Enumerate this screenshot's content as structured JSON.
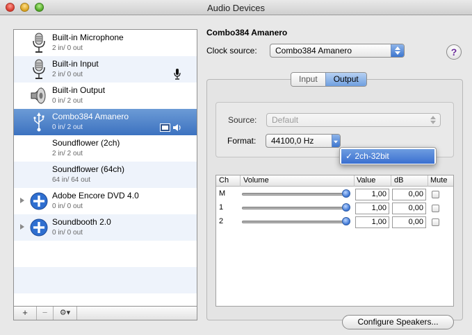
{
  "window": {
    "title": "Audio Devices"
  },
  "devices": [
    {
      "name": "Built-in Microphone",
      "io": "2 in/ 0 out",
      "icon": "microphone-icon"
    },
    {
      "name": "Built-in Input",
      "io": "2 in/ 0 out",
      "icon": "microphone-icon"
    },
    {
      "name": "Built-in Output",
      "io": "0 in/ 2 out",
      "icon": "speaker-icon"
    },
    {
      "name": "Combo384 Amanero",
      "io": "0 in/ 2 out",
      "icon": "usb-icon"
    },
    {
      "name": "Soundflower (2ch)",
      "io": "2 in/ 2 out",
      "icon": ""
    },
    {
      "name": "Soundflower (64ch)",
      "io": "64 in/ 64 out",
      "icon": ""
    },
    {
      "name": "Adobe Encore DVD 4.0",
      "io": "0 in/ 0 out",
      "icon": "aggregate-plus-icon"
    },
    {
      "name": "Soundbooth 2.0",
      "io": "0 in/ 0 out",
      "icon": "aggregate-plus-icon"
    }
  ],
  "toolbar": {
    "add_label": "+",
    "remove_label": "−",
    "gear_label": "⚙▾"
  },
  "detail": {
    "device_name": "Combo384 Amanero",
    "clock_source_label": "Clock source:",
    "clock_source_value": "Combo384 Amanero",
    "help_label": "?",
    "tabs": [
      "Input",
      "Output"
    ],
    "active_tab": "Output",
    "source_label": "Source:",
    "source_value": "Default",
    "format_label": "Format:",
    "format_rate": "44100,0 Hz",
    "format_menu_item": "✓ 2ch-32bit"
  },
  "channel_table": {
    "headers": {
      "ch": "Ch",
      "volume": "Volume",
      "value": "Value",
      "db": "dB",
      "mute": "Mute"
    },
    "rows": [
      {
        "ch": "M",
        "volume_fraction": 1.0,
        "value": "1,00",
        "db": "0,00",
        "mute": false
      },
      {
        "ch": "1",
        "volume_fraction": 1.0,
        "value": "1,00",
        "db": "0,00",
        "mute": false
      },
      {
        "ch": "2",
        "volume_fraction": 1.0,
        "value": "1,00",
        "db": "0,00",
        "mute": false
      }
    ]
  },
  "configure_button": "Configure Speakers...",
  "colors": {
    "selection": "#3c72c0",
    "accent": "#3a6fd0"
  }
}
